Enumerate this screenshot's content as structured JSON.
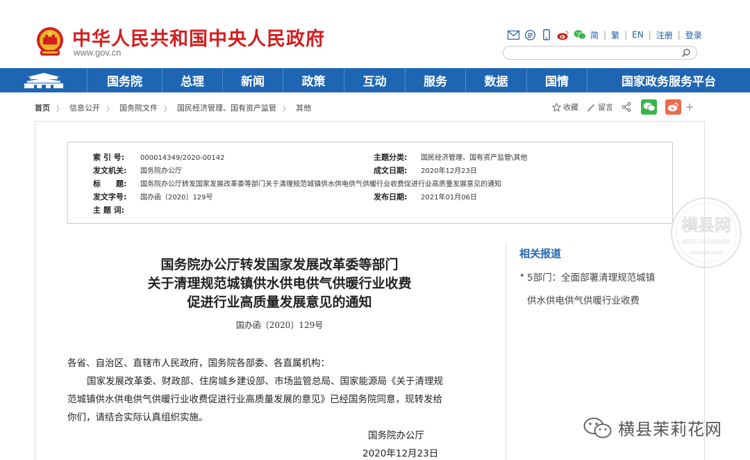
{
  "site": {
    "title": "中华人民共和国中央人民政府",
    "url": "www.gov.cn"
  },
  "top_links": {
    "simplified": "简",
    "traditional": "繁",
    "english": "EN",
    "register": "注册",
    "login": "登录",
    "separator": "|"
  },
  "icons": {
    "mail": "mail-icon",
    "rss": "rss-icon",
    "mobile": "mobile-icon",
    "weibo": "weibo-icon",
    "wechat": "wechat-icon",
    "search": "search-icon",
    "star": "star-icon",
    "pen": "pen-icon",
    "share": "share-icon",
    "plus": "plus-icon"
  },
  "colors": {
    "brand_red": "#d31e1e",
    "nav_blue": "#1e66b3",
    "wechat_green": "#3bb54a",
    "weibo_orange": "#f06a4b"
  },
  "nav": {
    "items": [
      {
        "label": "国务院"
      },
      {
        "label": "总理"
      },
      {
        "label": "新闻"
      },
      {
        "label": "政策"
      },
      {
        "label": "互动"
      },
      {
        "label": "服务"
      },
      {
        "label": "数据"
      },
      {
        "label": "国情"
      },
      {
        "label": "国家政务服务平台"
      }
    ]
  },
  "breadcrumb": {
    "home": "首页",
    "items": [
      "信息公开",
      "国务院文件",
      "国民经济管理、国有资产监管",
      "其他"
    ],
    "separator": "〉"
  },
  "tools": {
    "favorite": "收藏",
    "comment": "留言"
  },
  "meta": {
    "index_no_label": "索 引 号:",
    "index_no": "000014349/2020-00142",
    "category_label": "主题分类:",
    "category": "国民经济管理、国有资产监管\\其他",
    "issuer_label": "发文机关:",
    "issuer": "国务院办公厅",
    "written_date_label": "成文日期:",
    "written_date": "2020年12月23日",
    "title_label": "标　　题:",
    "title": "国务院办公厅转发国家发展改革委等部门关于清理规范城镇供水供电供气供暖行业收费促进行业高质量发展意见的通知",
    "doc_no_label": "发文字号:",
    "doc_no": "国办函〔2020〕129号",
    "publish_date_label": "发布日期:",
    "publish_date": "2021年01月06日",
    "keywords_label": "主 题 词:"
  },
  "document": {
    "title_line1": "国务院办公厅转发国家发展改革委等部门",
    "title_line2": "关于清理规范城镇供水供电供气供暖行业收费",
    "title_line3": "促进行业高质量发展意见的通知",
    "number": "国办函〔2020〕129号",
    "salutation": "各省、自治区、直辖市人民政府，国务院各部委、各直属机构：",
    "para_line1": "国家发展改革委、财政部、住房城乡建设部、市场监管总局、国家能源局《关于清理规",
    "para_line2": "范城镇供水供电供气供暖行业收费促进行业高质量发展的意见》已经国务院同意，现转发给",
    "para_line3": "你们，请结合实际认真组织实施。",
    "signer": "国务院办公厅",
    "date": "2020年12月23日"
  },
  "related": {
    "title": "相关报道",
    "bullet": "•",
    "item_line1": "5部门：全面部署清理规范城镇",
    "item_line2": "供水供电供气供暖行业收费"
  },
  "watermark": {
    "seal_text": "横县网",
    "seal_sub": "横县生活资讯品牌网站",
    "seal_url": "HXLOUR.COM",
    "wechat_text": "横县茉莉花网"
  }
}
